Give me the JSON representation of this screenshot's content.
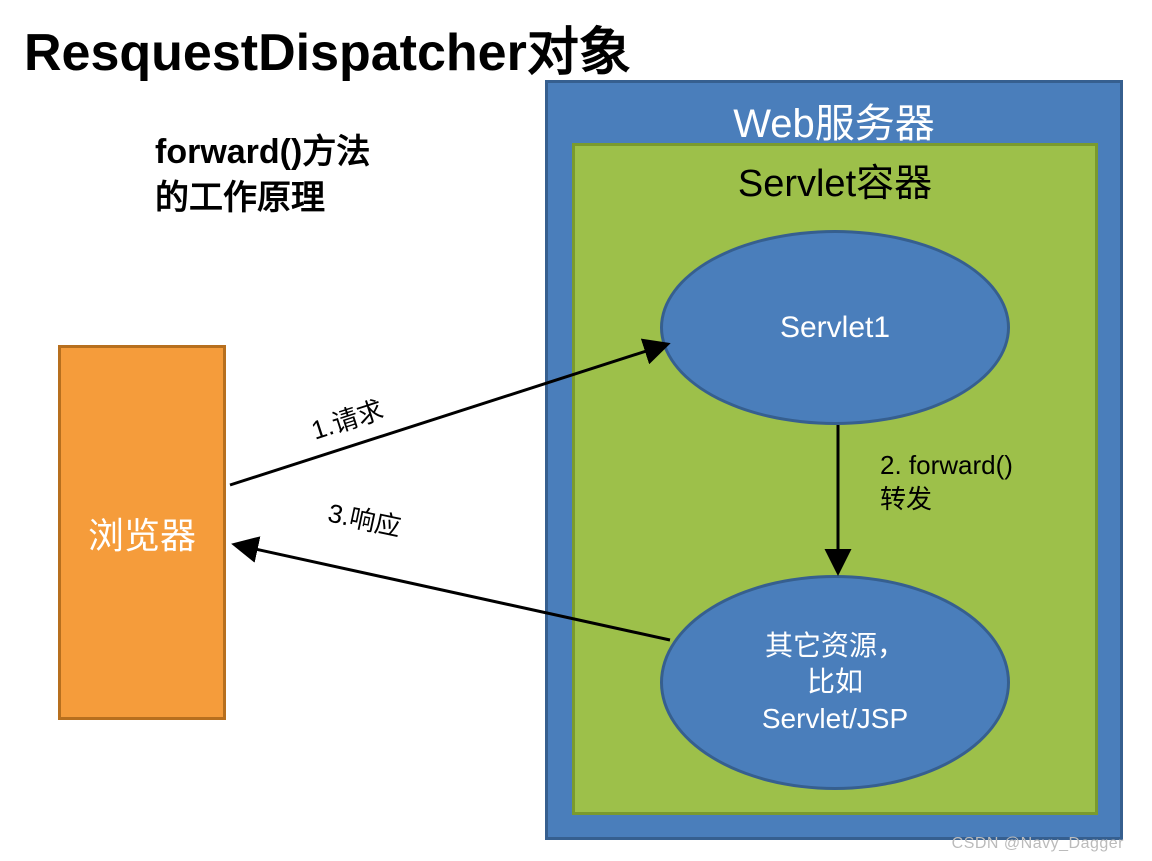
{
  "title": "ResquestDispatcher对象",
  "subtitle_line1": "forward()方法",
  "subtitle_line2": "的工作原理",
  "browser": "浏览器",
  "web_server": "Web服务器",
  "servlet_container": "Servlet容器",
  "servlet1": "Servlet1",
  "other_resource_line1": "其它资源，",
  "other_resource_line2": "比如",
  "other_resource_line3": "Servlet/JSP",
  "arrows": {
    "request": "1.请求",
    "forward_line1": "2. forward()",
    "forward_line2": "转发",
    "response": "3.响应"
  },
  "watermark": "CSDN @Navy_Dagger",
  "colors": {
    "orange_fill": "#f59c3b",
    "orange_border": "#b76f1e",
    "blue_fill": "#4a7ebb",
    "blue_border": "#365f8f",
    "green_fill": "#9dc04a",
    "green_border": "#7a9a2e"
  }
}
